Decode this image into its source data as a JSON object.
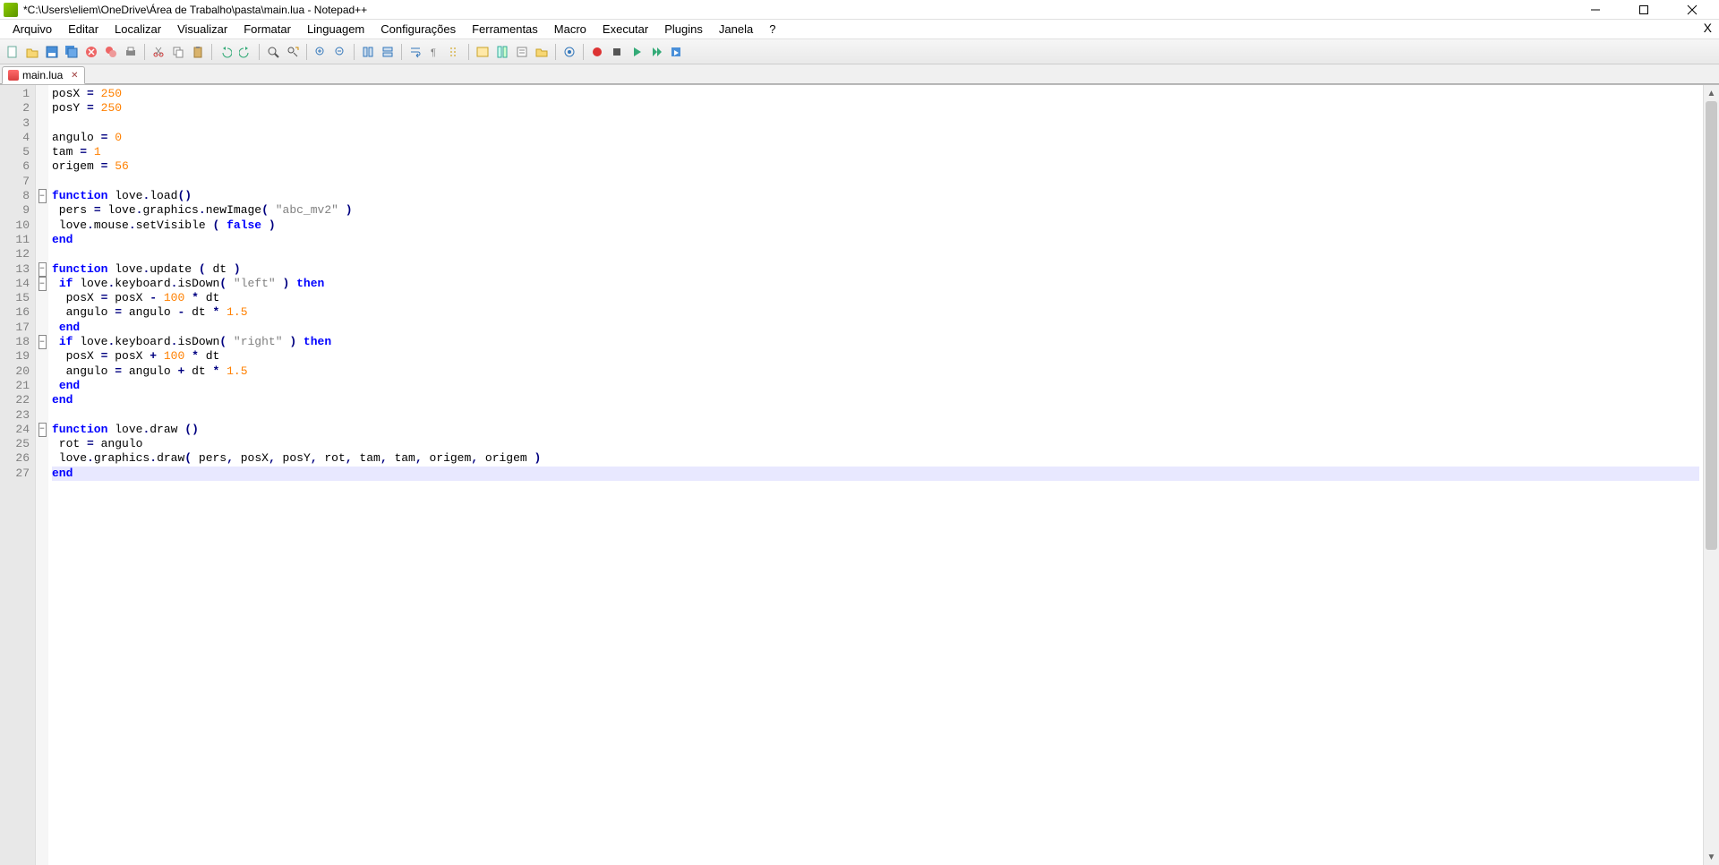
{
  "window": {
    "title": "*C:\\Users\\eliem\\OneDrive\\Área de Trabalho\\pasta\\main.lua - Notepad++"
  },
  "menu": {
    "items": [
      "Arquivo",
      "Editar",
      "Localizar",
      "Visualizar",
      "Formatar",
      "Linguagem",
      "Configurações",
      "Ferramentas",
      "Macro",
      "Executar",
      "Plugins",
      "Janela",
      "?"
    ],
    "close_x": "X"
  },
  "tabs": {
    "active": {
      "label": "main.lua",
      "close": "✕"
    }
  },
  "editor": {
    "current_line": 27,
    "lines": [
      {
        "n": 1,
        "fold": "",
        "segs": [
          [
            "id",
            "posX "
          ],
          [
            "op",
            "="
          ],
          [
            "id",
            " "
          ],
          [
            "num",
            "250"
          ]
        ]
      },
      {
        "n": 2,
        "fold": "",
        "segs": [
          [
            "id",
            "posY "
          ],
          [
            "op",
            "="
          ],
          [
            "id",
            " "
          ],
          [
            "num",
            "250"
          ]
        ]
      },
      {
        "n": 3,
        "fold": "",
        "segs": []
      },
      {
        "n": 4,
        "fold": "",
        "segs": [
          [
            "id",
            "angulo "
          ],
          [
            "op",
            "="
          ],
          [
            "id",
            " "
          ],
          [
            "num",
            "0"
          ]
        ]
      },
      {
        "n": 5,
        "fold": "",
        "segs": [
          [
            "id",
            "tam "
          ],
          [
            "op",
            "="
          ],
          [
            "id",
            " "
          ],
          [
            "num",
            "1"
          ]
        ]
      },
      {
        "n": 6,
        "fold": "",
        "segs": [
          [
            "id",
            "origem "
          ],
          [
            "op",
            "="
          ],
          [
            "id",
            " "
          ],
          [
            "num",
            "56"
          ]
        ]
      },
      {
        "n": 7,
        "fold": "",
        "segs": []
      },
      {
        "n": 8,
        "fold": "minus",
        "segs": [
          [
            "kw",
            "function"
          ],
          [
            "id",
            " love"
          ],
          [
            "op",
            "."
          ],
          [
            "id",
            "load"
          ],
          [
            "op",
            "()"
          ]
        ]
      },
      {
        "n": 9,
        "fold": "",
        "segs": [
          [
            "id",
            " pers "
          ],
          [
            "op",
            "="
          ],
          [
            "id",
            " love"
          ],
          [
            "op",
            "."
          ],
          [
            "id",
            "graphics"
          ],
          [
            "op",
            "."
          ],
          [
            "id",
            "newImage"
          ],
          [
            "op",
            "( "
          ],
          [
            "str",
            "\"abc_mv2\""
          ],
          [
            "op",
            " )"
          ]
        ]
      },
      {
        "n": 10,
        "fold": "",
        "segs": [
          [
            "id",
            " love"
          ],
          [
            "op",
            "."
          ],
          [
            "id",
            "mouse"
          ],
          [
            "op",
            "."
          ],
          [
            "id",
            "setVisible "
          ],
          [
            "op",
            "( "
          ],
          [
            "kw",
            "false"
          ],
          [
            "op",
            " )"
          ]
        ]
      },
      {
        "n": 11,
        "fold": "",
        "segs": [
          [
            "kw",
            "end"
          ]
        ]
      },
      {
        "n": 12,
        "fold": "",
        "segs": []
      },
      {
        "n": 13,
        "fold": "minus",
        "segs": [
          [
            "kw",
            "function"
          ],
          [
            "id",
            " love"
          ],
          [
            "op",
            "."
          ],
          [
            "id",
            "update "
          ],
          [
            "op",
            "("
          ],
          [
            "id",
            " dt "
          ],
          [
            "op",
            ")"
          ]
        ]
      },
      {
        "n": 14,
        "fold": "minus",
        "segs": [
          [
            "id",
            " "
          ],
          [
            "kw",
            "if"
          ],
          [
            "id",
            " love"
          ],
          [
            "op",
            "."
          ],
          [
            "id",
            "keyboard"
          ],
          [
            "op",
            "."
          ],
          [
            "id",
            "isDown"
          ],
          [
            "op",
            "( "
          ],
          [
            "str",
            "\"left\""
          ],
          [
            "op",
            " ) "
          ],
          [
            "kw",
            "then"
          ]
        ]
      },
      {
        "n": 15,
        "fold": "",
        "segs": [
          [
            "id",
            "  posX "
          ],
          [
            "op",
            "="
          ],
          [
            "id",
            " posX "
          ],
          [
            "op",
            "-"
          ],
          [
            "id",
            " "
          ],
          [
            "num",
            "100"
          ],
          [
            "id",
            " "
          ],
          [
            "op",
            "*"
          ],
          [
            "id",
            " dt"
          ]
        ]
      },
      {
        "n": 16,
        "fold": "",
        "segs": [
          [
            "id",
            "  angulo "
          ],
          [
            "op",
            "="
          ],
          [
            "id",
            " angulo "
          ],
          [
            "op",
            "-"
          ],
          [
            "id",
            " dt "
          ],
          [
            "op",
            "*"
          ],
          [
            "id",
            " "
          ],
          [
            "num",
            "1.5"
          ]
        ]
      },
      {
        "n": 17,
        "fold": "",
        "segs": [
          [
            "id",
            " "
          ],
          [
            "kw",
            "end"
          ]
        ]
      },
      {
        "n": 18,
        "fold": "minus",
        "segs": [
          [
            "id",
            " "
          ],
          [
            "kw",
            "if"
          ],
          [
            "id",
            " love"
          ],
          [
            "op",
            "."
          ],
          [
            "id",
            "keyboard"
          ],
          [
            "op",
            "."
          ],
          [
            "id",
            "isDown"
          ],
          [
            "op",
            "( "
          ],
          [
            "str",
            "\"right\""
          ],
          [
            "op",
            " ) "
          ],
          [
            "kw",
            "then"
          ]
        ]
      },
      {
        "n": 19,
        "fold": "",
        "segs": [
          [
            "id",
            "  posX "
          ],
          [
            "op",
            "="
          ],
          [
            "id",
            " posX "
          ],
          [
            "op",
            "+"
          ],
          [
            "id",
            " "
          ],
          [
            "num",
            "100"
          ],
          [
            "id",
            " "
          ],
          [
            "op",
            "*"
          ],
          [
            "id",
            " dt"
          ]
        ]
      },
      {
        "n": 20,
        "fold": "",
        "segs": [
          [
            "id",
            "  angulo "
          ],
          [
            "op",
            "="
          ],
          [
            "id",
            " angulo "
          ],
          [
            "op",
            "+"
          ],
          [
            "id",
            " dt "
          ],
          [
            "op",
            "*"
          ],
          [
            "id",
            " "
          ],
          [
            "num",
            "1.5"
          ]
        ]
      },
      {
        "n": 21,
        "fold": "",
        "segs": [
          [
            "id",
            " "
          ],
          [
            "kw",
            "end"
          ]
        ]
      },
      {
        "n": 22,
        "fold": "",
        "segs": [
          [
            "kw",
            "end"
          ]
        ]
      },
      {
        "n": 23,
        "fold": "",
        "segs": []
      },
      {
        "n": 24,
        "fold": "minus",
        "segs": [
          [
            "kw",
            "function"
          ],
          [
            "id",
            " love"
          ],
          [
            "op",
            "."
          ],
          [
            "id",
            "draw "
          ],
          [
            "op",
            "()"
          ]
        ]
      },
      {
        "n": 25,
        "fold": "",
        "segs": [
          [
            "id",
            " rot "
          ],
          [
            "op",
            "="
          ],
          [
            "id",
            " angulo"
          ]
        ]
      },
      {
        "n": 26,
        "fold": "",
        "segs": [
          [
            "id",
            " love"
          ],
          [
            "op",
            "."
          ],
          [
            "id",
            "graphics"
          ],
          [
            "op",
            "."
          ],
          [
            "id",
            "draw"
          ],
          [
            "op",
            "("
          ],
          [
            "id",
            " pers"
          ],
          [
            "op",
            ","
          ],
          [
            "id",
            " posX"
          ],
          [
            "op",
            ","
          ],
          [
            "id",
            " posY"
          ],
          [
            "op",
            ","
          ],
          [
            "id",
            " rot"
          ],
          [
            "op",
            ","
          ],
          [
            "id",
            " tam"
          ],
          [
            "op",
            ","
          ],
          [
            "id",
            " tam"
          ],
          [
            "op",
            ","
          ],
          [
            "id",
            " origem"
          ],
          [
            "op",
            ","
          ],
          [
            "id",
            " origem "
          ],
          [
            "op",
            ")"
          ]
        ]
      },
      {
        "n": 27,
        "fold": "",
        "segs": [
          [
            "kw",
            "end"
          ]
        ]
      }
    ]
  }
}
